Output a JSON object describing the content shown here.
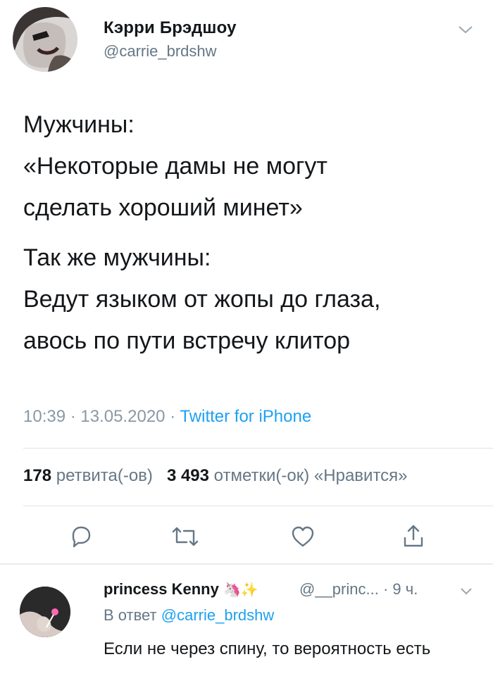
{
  "tweet": {
    "author_name": "Кэрри Брэдшоу",
    "author_handle": "@carrie_brdshw",
    "lines": [
      [
        "Мужчины:",
        "«Некоторые дамы не могут",
        "сделать хороший минет»"
      ],
      [
        "Так же мужчины:",
        "Ведут языком от жопы до глаза,",
        "авось по пути встречу клитор"
      ]
    ],
    "time": "10:39",
    "date": "13.05.2020",
    "source": "Twitter for iPhone",
    "retweets_count": "178",
    "retweets_label": "ретвита(-ов)",
    "likes_count": "3 493",
    "likes_label": "отметки(-ок) «Нравится»",
    "icons": [
      "reply-icon",
      "retweet-icon",
      "like-icon",
      "share-icon"
    ]
  },
  "reply": {
    "author_name": "princess Kenny",
    "author_emoji": "🦄✨",
    "author_handle": "@__princ...",
    "time": "9 ч.",
    "in_reply_label": "В ответ",
    "in_reply_handle": "@carrie_brdshw",
    "text": "Если не через спину, то вероятность есть"
  },
  "colors": {
    "link": "#1da1f2",
    "secondary_text": "#657786",
    "primary_text": "#14171a",
    "icon": "#657786"
  }
}
